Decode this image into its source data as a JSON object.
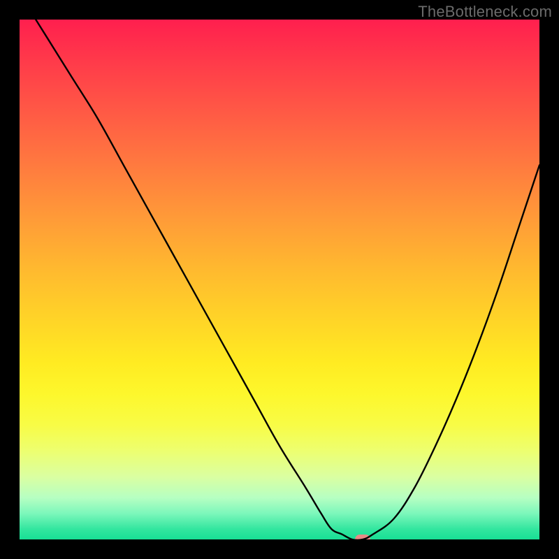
{
  "watermark": "TheBottleneck.com",
  "colors": {
    "background": "#000000",
    "watermark": "#6b6b6b",
    "curve": "#000000",
    "marker": "#e98b86",
    "gradient_top": "#ff1f4e",
    "gradient_bottom": "#18df95"
  },
  "chart_data": {
    "type": "line",
    "title": "",
    "xlabel": "",
    "ylabel": "",
    "xlim": [
      0,
      100
    ],
    "ylim": [
      0,
      100
    ],
    "grid": false,
    "legend": false,
    "series": [
      {
        "name": "bottleneck-curve",
        "x": [
          0,
          5,
          10,
          15,
          20,
          25,
          30,
          35,
          40,
          45,
          50,
          55,
          58,
          60,
          62,
          64,
          66,
          68,
          72,
          76,
          80,
          84,
          88,
          92,
          96,
          100
        ],
        "values": [
          105,
          97,
          89,
          81,
          72,
          63,
          54,
          45,
          36,
          27,
          18,
          10,
          5,
          2,
          1,
          0,
          0,
          1,
          4,
          10,
          18,
          27,
          37,
          48,
          60,
          72
        ]
      }
    ],
    "marker": {
      "x": 66,
      "y": 0
    },
    "note": "x and y are in percent of plot area; y=0 is bottom, y=100 is top. Values above 100 are clipped by the plot area."
  }
}
